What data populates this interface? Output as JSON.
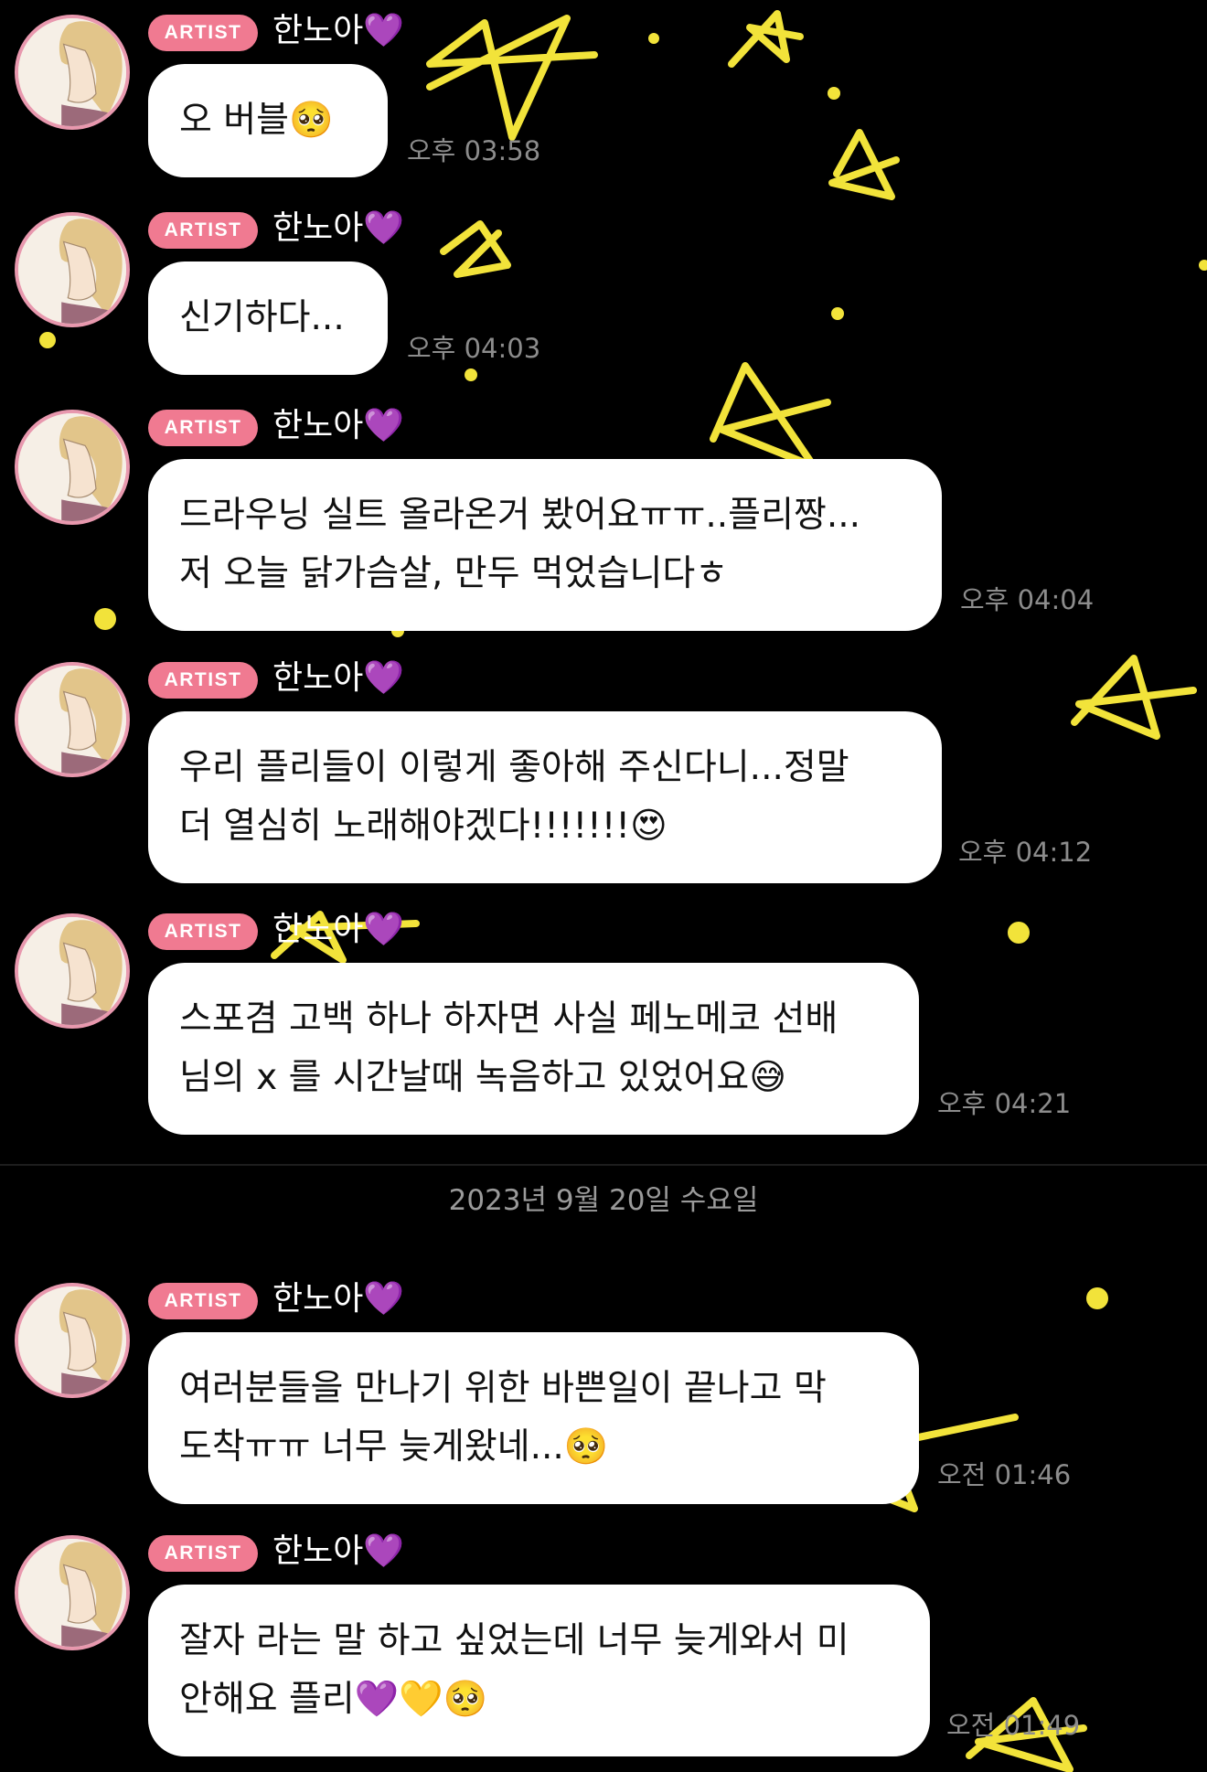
{
  "artist_badge": "ARTIST",
  "sender_name": "한노아💜",
  "date_separator": "2023년 9월 20일 수요일",
  "colors": {
    "background": "#000000",
    "badge": "#f07a91",
    "avatar_ring": "#e898ae",
    "stars": "#f2e33a"
  },
  "messages": [
    {
      "lines": [
        "오 버블🥺"
      ],
      "time": "오후 03:58"
    },
    {
      "lines": [
        "신기하다..."
      ],
      "time": "오후 04:03"
    },
    {
      "lines": [
        "드라우닝 실트 올라온거 봤어요ㅠㅠ..플리짱...",
        "저 오늘 닭가슴살, 만두 먹었습니다ㅎ"
      ],
      "time": "오후 04:04"
    },
    {
      "lines": [
        "우리 플리들이 이렇게 좋아해 주신다니...정말",
        "더 열심히 노래해야겠다!!!!!!!😍"
      ],
      "time": "오후 04:12"
    },
    {
      "lines": [
        "스포겸 고백 하나 하자면 사실 페노메코 선배",
        "님의 x 를 시간날때 녹음하고 있었어요😅"
      ],
      "time": "오후 04:21"
    },
    {
      "lines": [
        "여러분들을 만나기 위한 바쁜일이 끝나고 막",
        "도착ㅠㅠ 너무 늦게왔네...🥺"
      ],
      "time": "오전 01:46"
    },
    {
      "lines": [
        "잘자 라는 말 하고 싶었는데 너무 늦게와서 미",
        "안해요 플리💜💛🥺"
      ],
      "time": "오전 01:49"
    }
  ]
}
